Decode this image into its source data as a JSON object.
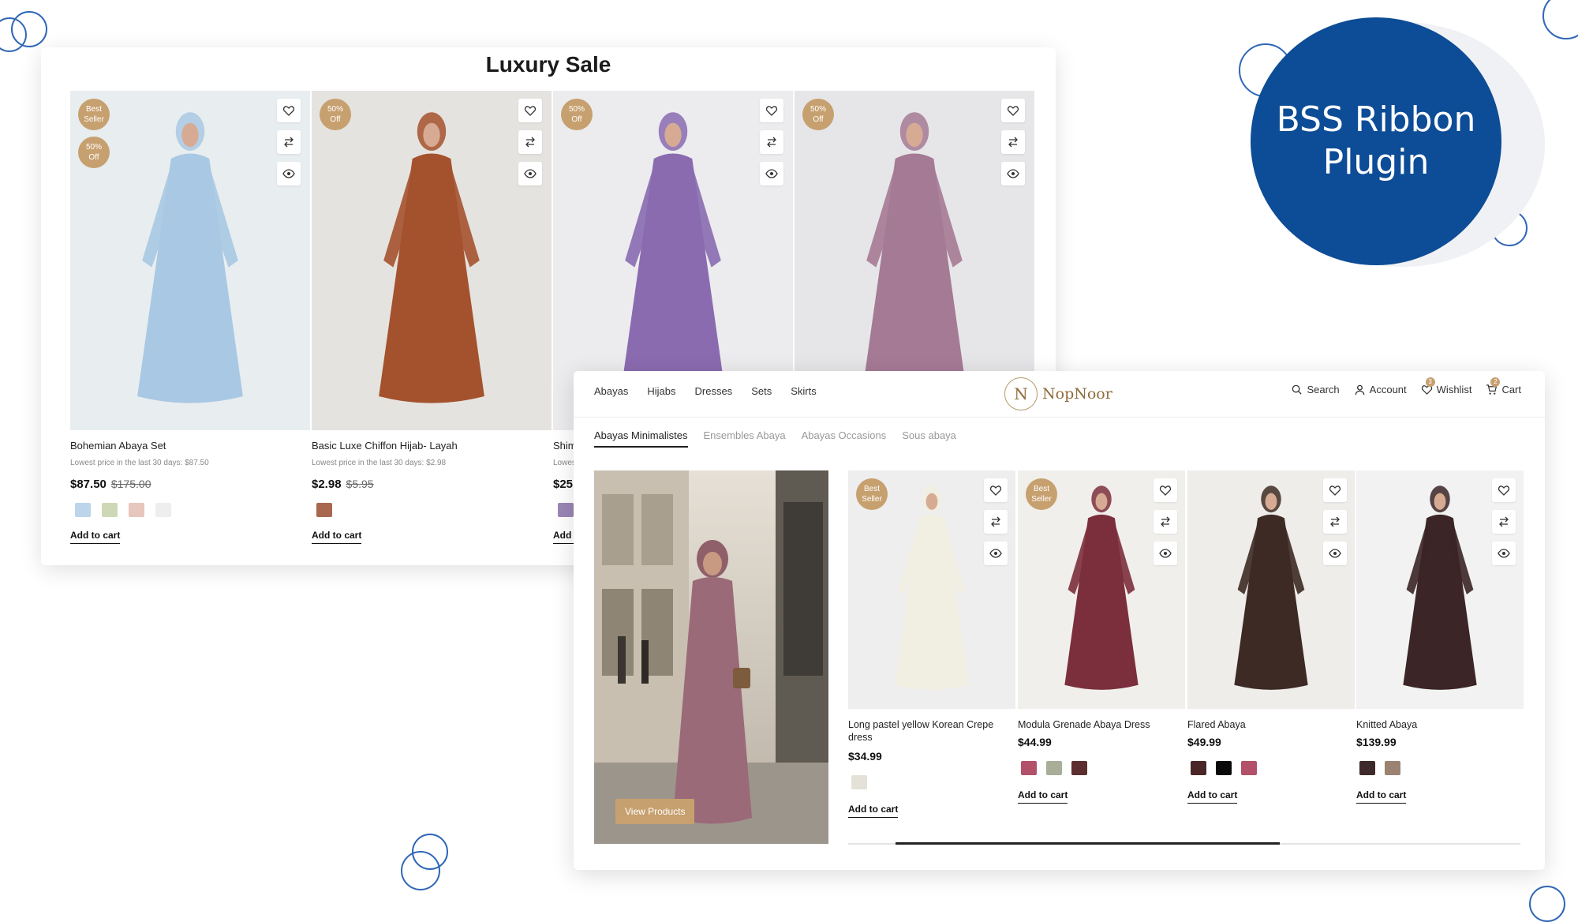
{
  "back_panel": {
    "title": "Luxury Sale",
    "products": [
      {
        "name": "Bohemian Abaya Set",
        "lowest": "Lowest price in the last 30 days: $87.50",
        "price": "$87.50",
        "old_price": "$175.00",
        "badges": [
          [
            "Best",
            "Seller"
          ],
          [
            "50%",
            "Off"
          ]
        ],
        "swatches": [
          "#bcd5ea",
          "#cfd8b6",
          "#e7c6bd",
          "#eeeeee"
        ],
        "add": "Add to cart",
        "bg": "#e8edf0",
        "dress": "#a9c8e3"
      },
      {
        "name": "Basic Luxe Chiffon Hijab- Layah",
        "lowest": "Lowest price in the last 30 days: $2.98",
        "price": "$2.98",
        "old_price": "$5.95",
        "badges": [
          [
            "50%",
            "Off"
          ]
        ],
        "swatches": [
          "#a8674f"
        ],
        "add": "Add to cart",
        "bg": "#e5e3df",
        "dress": "#a4522e"
      },
      {
        "name": "Shim",
        "lowest": "Lowes",
        "price": "$25.",
        "old_price": "",
        "badges": [
          [
            "50%",
            "Off"
          ]
        ],
        "swatches": [
          "#9b86b6"
        ],
        "add": "Add t",
        "bg": "#ececee",
        "dress": "#8a6bb0"
      },
      {
        "name": "",
        "lowest": "",
        "price": "",
        "old_price": "",
        "badges": [
          [
            "50%",
            "Off"
          ]
        ],
        "swatches": [],
        "add": "",
        "bg": "#e6e6e9",
        "dress": "#a57a95"
      }
    ]
  },
  "front_panel": {
    "nav": [
      "Abayas",
      "Hijabs",
      "Dresses",
      "Sets",
      "Skirts"
    ],
    "logo": {
      "mono": "N",
      "word": "NopNoor"
    },
    "util": {
      "search": "Search",
      "account": "Account",
      "wishlist": "Wishlist",
      "wishlist_count": "3",
      "cart": "Cart",
      "cart_count": "2"
    },
    "tabs": [
      "Abayas Minimalistes",
      "Ensembles Abaya",
      "Abayas Occasions",
      "Sous abaya"
    ],
    "feature_button": "View Products",
    "products": [
      {
        "name": "Long pastel yellow Korean Crepe dress",
        "price": "$34.99",
        "badges": [
          [
            "Best",
            "Seller"
          ]
        ],
        "swatches": [
          "#e3e1d8"
        ],
        "add": "Add to cart",
        "bg": "#eeeeee",
        "dress": "#f1eee2"
      },
      {
        "name": "Modula Grenade Abaya Dress",
        "price": "$44.99",
        "badges": [
          [
            "Best",
            "Seller"
          ]
        ],
        "swatches": [
          "#b3506a",
          "#a8ae98",
          "#5c2e30"
        ],
        "add": "Add to cart",
        "bg": "#f1efeb",
        "dress": "#7b2f3c"
      },
      {
        "name": "Flared Abaya",
        "price": "$49.99",
        "badges": [],
        "swatches": [
          "#4a2626",
          "#0a0a0a",
          "#b3506a"
        ],
        "add": "Add to cart",
        "bg": "#efedea",
        "dress": "#3d2a25"
      },
      {
        "name": "Knitted Abaya",
        "price": "$139.99",
        "badges": [],
        "swatches": [
          "#3e2a2a",
          "#9b8272"
        ],
        "add": "Add to cart",
        "bg": "#f2f2f2",
        "dress": "#3b2526"
      }
    ]
  },
  "ribbon": {
    "line1": "BSS Ribbon",
    "line2": "Plugin"
  }
}
